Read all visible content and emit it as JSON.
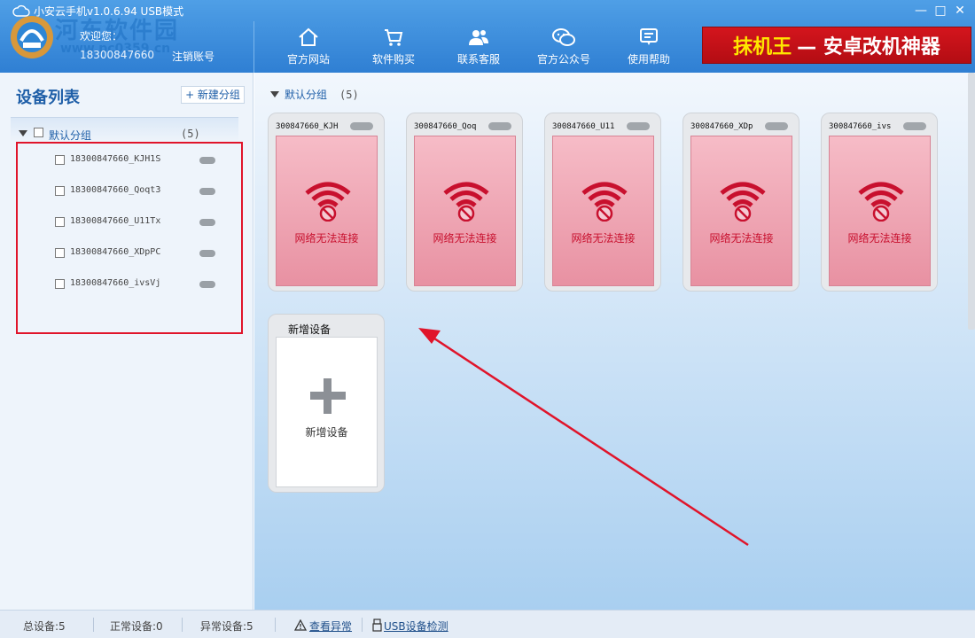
{
  "window": {
    "title": "小安云手机v1.0.6.94 USB模式",
    "controls": [
      "—",
      "□",
      "✕"
    ]
  },
  "header": {
    "watermark": "河东软件园",
    "watermark_url": "www.pc0359.cn",
    "welcome": "欢迎您：",
    "account": "18300847660",
    "logout": "注销账号",
    "nav": [
      {
        "label": "官方网站",
        "icon": "home-icon"
      },
      {
        "label": "软件购买",
        "icon": "cart-icon"
      },
      {
        "label": "联系客服",
        "icon": "users-icon"
      },
      {
        "label": "官方公众号",
        "icon": "wechat-icon"
      },
      {
        "label": "使用帮助",
        "icon": "help-icon"
      }
    ],
    "banner_highlight": "抹机王",
    "banner_rest": "— 安卓改机神器"
  },
  "sidebar": {
    "title": "设备列表",
    "new_group": "+ 新建分组",
    "group_name": "默认分组",
    "group_count": "(5)",
    "devices": [
      "18300847660_KJH1S",
      "18300847660_Qoqt3",
      "18300847660_U11Tx",
      "18300847660_XDpPC",
      "18300847660_ivsVj"
    ]
  },
  "main": {
    "group_name": "默认分组",
    "group_count": "(5)",
    "cards": [
      {
        "name": "300847660_KJH",
        "status": "网络无法连接"
      },
      {
        "name": "300847660_Qoq",
        "status": "网络无法连接"
      },
      {
        "name": "300847660_U11",
        "status": "网络无法连接"
      },
      {
        "name": "300847660_XDp",
        "status": "网络无法连接"
      },
      {
        "name": "300847660_ivs",
        "status": "网络无法连接"
      }
    ],
    "add_title": "新增设备",
    "add_label": "新增设备"
  },
  "status": {
    "total": "总设备:5",
    "normal": "正常设备:0",
    "abnormal": "异常设备:5",
    "view_abnormal": "查看异常",
    "usb_check": "USB设备检测"
  },
  "colors": {
    "header_blue": "#3a8ad9",
    "banner_red": "#c8121a",
    "error_red": "#c8102e",
    "annotation_red": "#e0142a"
  }
}
